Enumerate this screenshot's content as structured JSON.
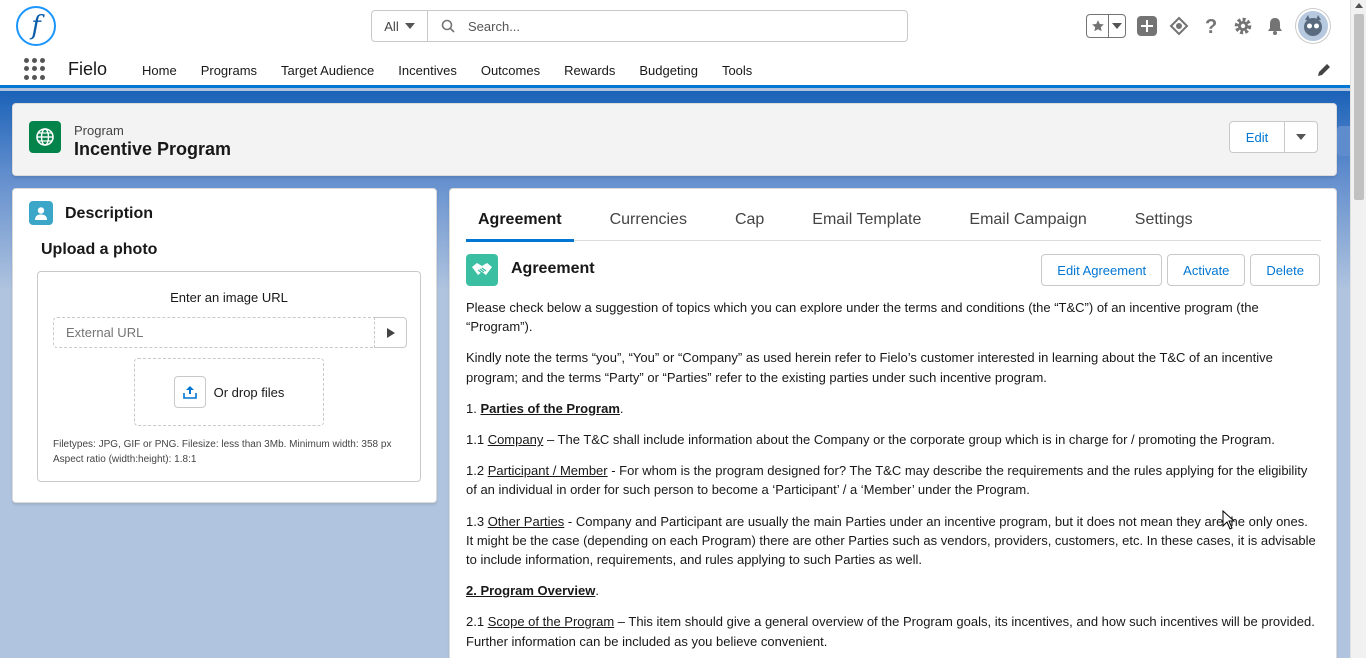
{
  "header": {
    "logo_letter": "f",
    "search_scope": "All",
    "search_placeholder": "Search..."
  },
  "nav": {
    "app_name": "Fielo",
    "items": [
      "Home",
      "Programs",
      "Target Audience",
      "Incentives",
      "Outcomes",
      "Rewards",
      "Budgeting",
      "Tools"
    ]
  },
  "record": {
    "type": "Program",
    "title": "Incentive Program",
    "edit_label": "Edit"
  },
  "description_card": {
    "title": "Description",
    "upload_title": "Upload a photo",
    "image_url_label": "Enter an image URL",
    "url_placeholder": "External URL",
    "drop_label": "Or drop files",
    "filetypes_line1": "Filetypes: JPG, GIF or PNG. Filesize: less than 3Mb. Minimum width: 358 px",
    "filetypes_line2": "Aspect ratio (width:height): 1.8:1"
  },
  "tabs": [
    "Agreement",
    "Currencies",
    "Cap",
    "Email Template",
    "Email Campaign",
    "Settings"
  ],
  "agreement": {
    "title": "Agreement",
    "actions": [
      "Edit Agreement",
      "Activate",
      "Delete"
    ],
    "p1": "Please check below a suggestion of topics which you can explore under the terms and conditions (the “T&C”) of an incentive program (the “Program”).",
    "p2": "Kindly note the terms “you”, “You” or “Company” as used herein refer to Fielo’s customer interested in learning about the T&C of an incentive program; and the terms “Party” or “Parties” refer to the existing parties under such incentive program.",
    "s1_num": "1. ",
    "s1_title": "Parties of the Program",
    "s1_end": ".",
    "s11_num": "1.1 ",
    "s11_term": "Company",
    "s11_text": " – The T&C shall include information about the Company or the corporate group which is in charge for / promoting the Program.",
    "s12_num": "1.2 ",
    "s12_term": "Participant / Member",
    "s12_text": " - For whom is the program designed for? The T&C may describe the requirements and the rules applying for the eligibility of an individual in order for such person to become a ‘Participant’ / a ‘Member’ under the Program.",
    "s13_num": "1.3 ",
    "s13_term": "Other Parties",
    "s13_text": " - Company and Participant are usually the main Parties under an incentive program, but it does not mean they are the only ones. It might be the case (depending on each Program) there are other Parties such as vendors, providers, customers, etc. In these cases, it is advisable to include information, requirements, and rules applying to such Parties as well.",
    "s2_title": "2. Program Overview",
    "s2_end": ".",
    "s21_num": "2.1 ",
    "s21_term": "Scope of the Program",
    "s21_text": " – This item should give a general overview of the Program goals, its incentives, and how such incentives will be provided. Further information can be included as you believe convenient."
  },
  "colors": {
    "brand_blue": "#0176d3",
    "record_icon": "#04844b",
    "agreement_icon": "#3bbfa3",
    "description_icon": "#3ba6c7"
  }
}
